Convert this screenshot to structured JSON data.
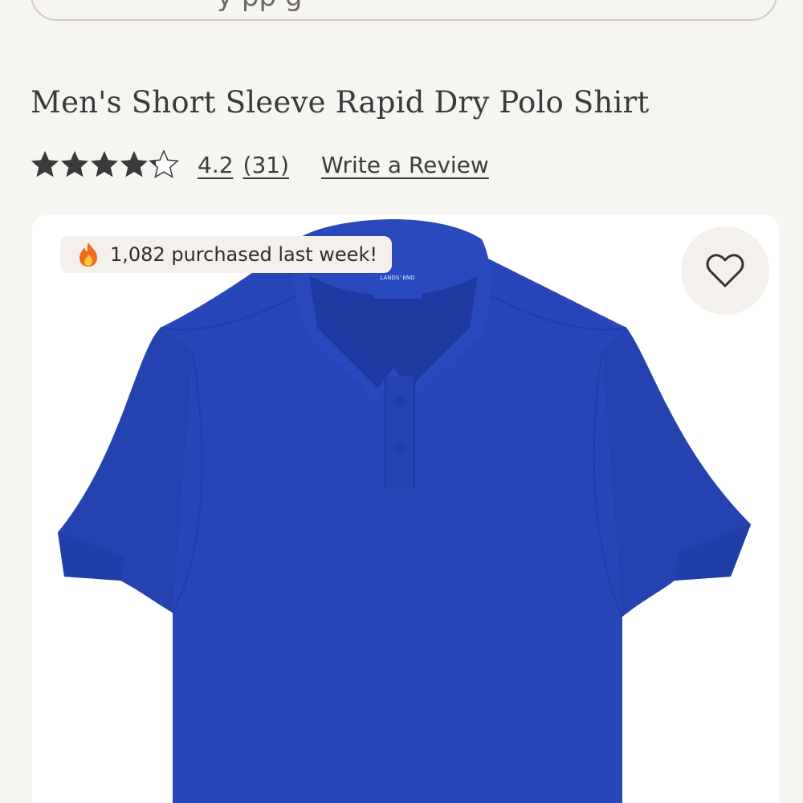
{
  "search": {
    "visible_text": "y     pp g"
  },
  "product": {
    "title": "Men's Short Sleeve Rapid Dry Polo Shirt",
    "rating_value": "4.2",
    "review_count": "(31)",
    "write_review_label": "Write a Review",
    "stars_filled": 4.2,
    "stars_total": 5,
    "purchase_badge": "1,082 purchased last week!",
    "label_brand": "LANDS' END"
  },
  "colors": {
    "background": "#f7f5f2",
    "shirt_blue": "#2747b8",
    "star_fill": "#3a3a3a",
    "badge_bg": "#f4f1ec"
  },
  "icons": {
    "search": "search-icon",
    "star": "star-icon",
    "fire": "fire-icon",
    "heart": "heart-icon"
  }
}
